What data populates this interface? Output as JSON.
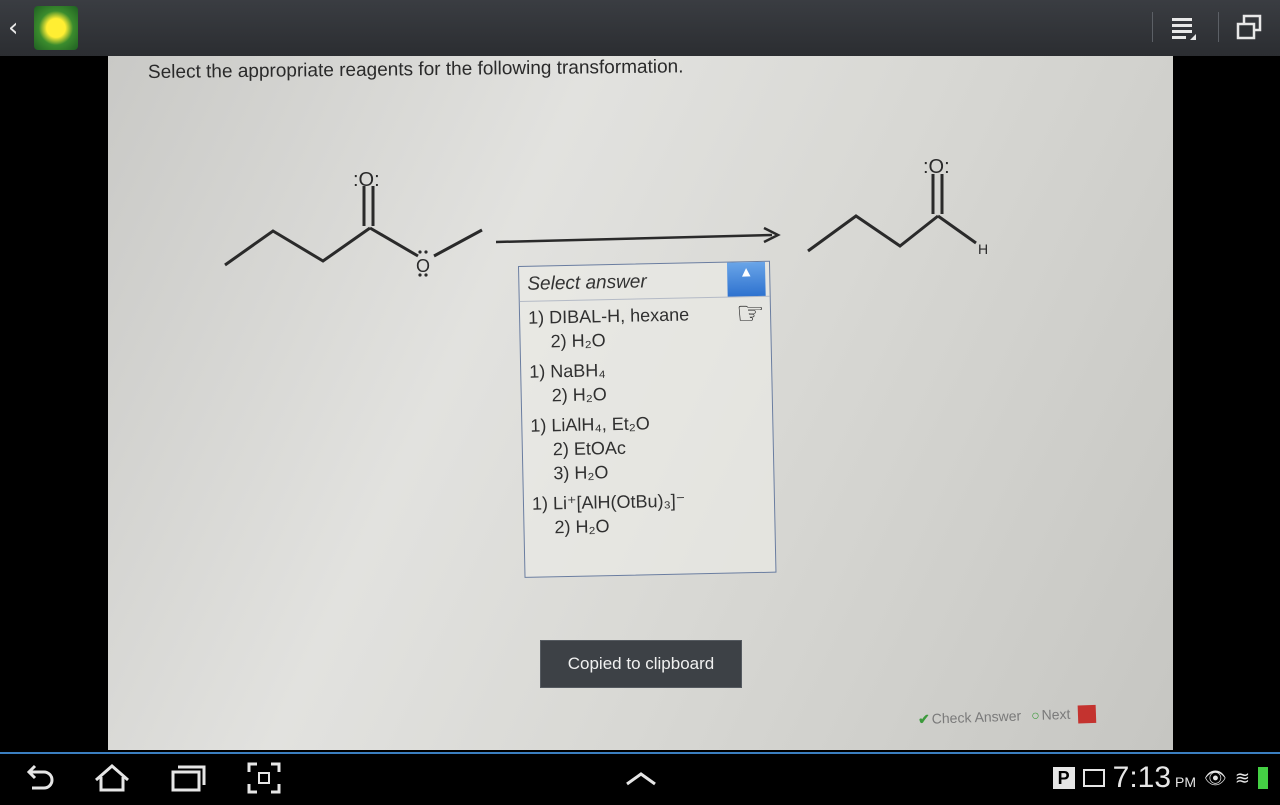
{
  "topbar": {
    "back_icon": "chevron-left-icon",
    "app_icon": "gallery-flower-icon",
    "menu_icon": "list-menu-icon",
    "window_icon": "popup-window-icon"
  },
  "photo": {
    "question": "Select the appropriate reagents for the following transformation.",
    "reactant_lone_pair_label": ":O:",
    "ester_oxygen_label": "O",
    "product_lone_pair_label": ":O:",
    "product_h_label": "H",
    "select": {
      "placeholder": "Select answer",
      "options": [
        {
          "steps": [
            "1) DIBAL-H, hexane",
            "2) H₂O"
          ]
        },
        {
          "steps": [
            "1) NaBH₄",
            "2) H₂O"
          ]
        },
        {
          "steps": [
            "1) LiAlH₄, Et₂O",
            "2) EtOAc",
            "3) H₂O"
          ]
        },
        {
          "steps": [
            "1) Li⁺[AlH(OtBu)₃]⁻",
            "2) H₂O"
          ]
        }
      ]
    },
    "footer": {
      "check_answer": "Check Answer",
      "next": "Next"
    }
  },
  "toast": {
    "message": "Copied to clipboard"
  },
  "navbar": {
    "back_icon": "back-icon",
    "home_icon": "home-icon",
    "recents_icon": "recent-apps-icon",
    "screenshot_icon": "screenshot-icon",
    "up_icon": "chevron-up-icon"
  },
  "status": {
    "time": "7:13",
    "ampm": "PM",
    "p_badge": "P"
  }
}
